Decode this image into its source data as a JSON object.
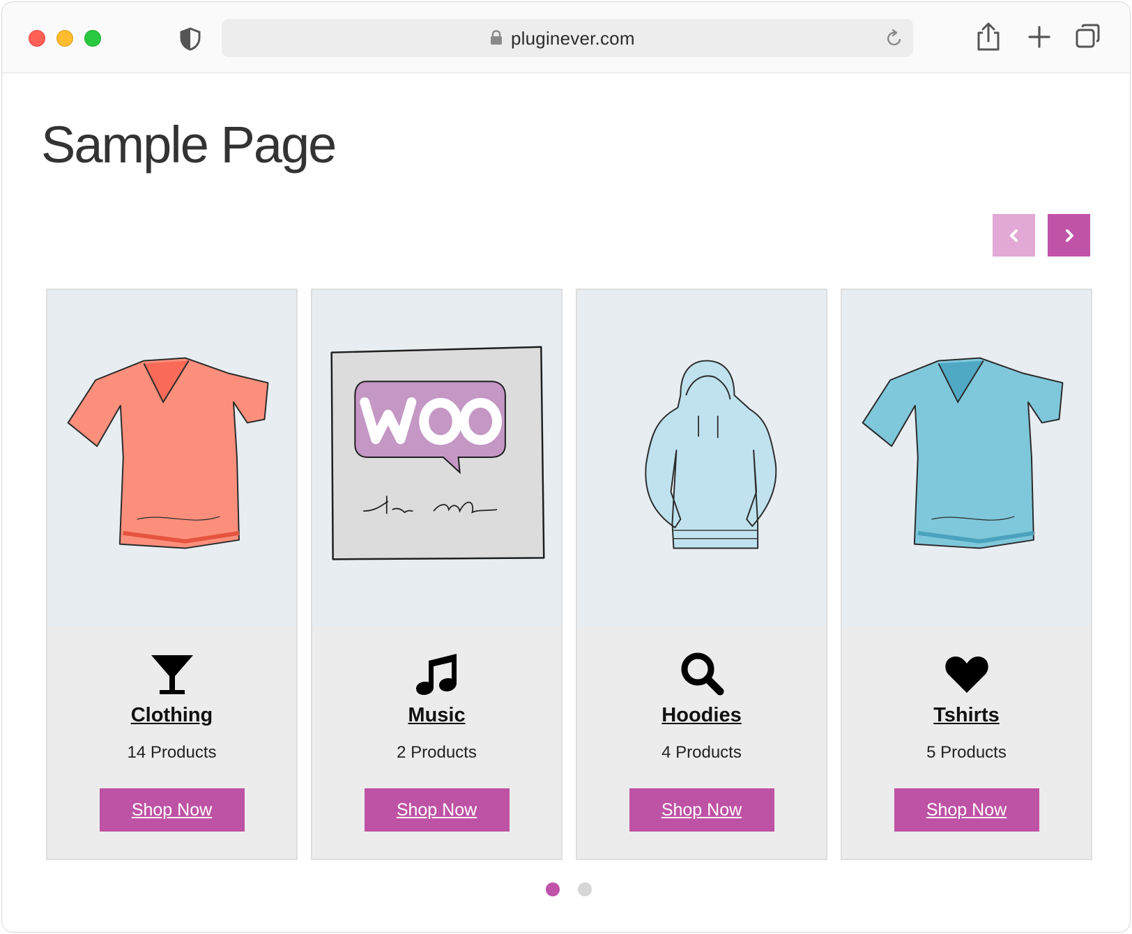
{
  "browser": {
    "url": "pluginever.com"
  },
  "page": {
    "title": "Sample Page"
  },
  "carousel": {
    "prev_label": "previous",
    "next_label": "next",
    "page_count": 2,
    "active_page": 1,
    "colors": {
      "accent": "#c052a8",
      "accent_light": "#e2a8d6"
    },
    "cards": [
      {
        "image": "red-vneck-tshirt",
        "icon": "cocktail-glass-icon",
        "name": "Clothing",
        "count": "14 Products",
        "button": "Shop Now"
      },
      {
        "image": "woo-the-single-album",
        "icon": "music-note-icon",
        "name": "Music",
        "count": "2 Products",
        "button": "Shop Now"
      },
      {
        "image": "light-blue-hoodie",
        "icon": "search-icon",
        "name": "Hoodies",
        "count": "4 Products",
        "button": "Shop Now"
      },
      {
        "image": "blue-vneck-tshirt",
        "icon": "heart-icon",
        "name": "Tshirts",
        "count": "5 Products",
        "button": "Shop Now"
      }
    ]
  }
}
